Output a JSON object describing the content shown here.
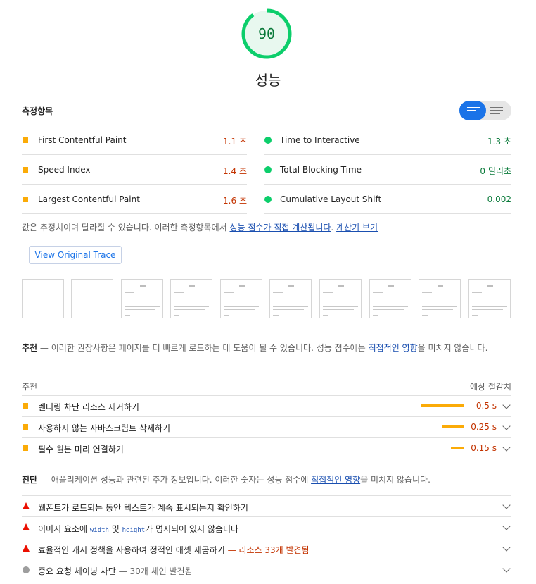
{
  "gauge": {
    "score": "90",
    "score_fraction": 0.9,
    "title": "성능",
    "color": "#0cce6b"
  },
  "metrics": {
    "title": "측정항목",
    "left": [
      {
        "label": "First Contentful Paint",
        "value": "1.1 초",
        "status": "average"
      },
      {
        "label": "Speed Index",
        "value": "1.4 초",
        "status": "average"
      },
      {
        "label": "Largest Contentful Paint",
        "value": "1.6 초",
        "status": "average"
      }
    ],
    "right": [
      {
        "label": "Time to Interactive",
        "value": "1.3 초",
        "status": "pass"
      },
      {
        "label": "Total Blocking Time",
        "value": "0 밀리초",
        "status": "pass"
      },
      {
        "label": "Cumulative Layout Shift",
        "value": "0.002",
        "status": "pass"
      }
    ]
  },
  "note": {
    "text": "값은 추정치이며 달라질 수 있습니다. 이러한 측정항목에서 ",
    "link1": "성능 점수가 직접 계산됩니다",
    "sep": ". ",
    "link2": "계산기 보기"
  },
  "trace_button": "View Original Trace",
  "opportunities": {
    "intro_bold": "추천",
    "intro_text": " — 이러한 권장사항은 페이지를 더 빠르게 로드하는 데 도움이 될 수 있습니다. 성능 점수에는 ",
    "intro_link": "직접적인 영향",
    "intro_tail": "을 미치지 않습니다.",
    "col_left": "추천",
    "col_right": "예상 절감치",
    "items": [
      {
        "label": "렌더링 차단 리소스 제거하기",
        "value": "0.5 s",
        "savings": 0.5
      },
      {
        "label": "사용하지 않는 자바스크립트 삭제하기",
        "value": "0.25 s",
        "savings": 0.25
      },
      {
        "label": "필수 원본 미리 연결하기",
        "value": "0.15 s",
        "savings": 0.15
      }
    ]
  },
  "diagnostics": {
    "intro_bold": "진단",
    "intro_text": " — 애플리케이션 성능과 관련된 추가 정보입니다. 이러한 숫자는 성능 점수에 ",
    "intro_link": "직접적인 영향",
    "intro_tail": "을 미치지 않습니다.",
    "items": [
      {
        "label": "웹폰트가 로드되는 동안 텍스트가 계속 표시되는지 확인하기",
        "status": "fail"
      },
      {
        "label_a": "이미지 요소에 ",
        "code1": "width",
        "label_b": " 및 ",
        "code2": "height",
        "label_c": "가 명시되어 있지 않습니다",
        "status": "fail"
      },
      {
        "label": "효율적인 캐시 정책을 사용하여 정적인 애셋 제공하기",
        "sub": " — 리소스 33개 발견됨",
        "status": "fail"
      },
      {
        "label": "중요 요청 체이닝 차단",
        "sub": " — 30개 체인 발견됨",
        "status": "info"
      }
    ]
  }
}
